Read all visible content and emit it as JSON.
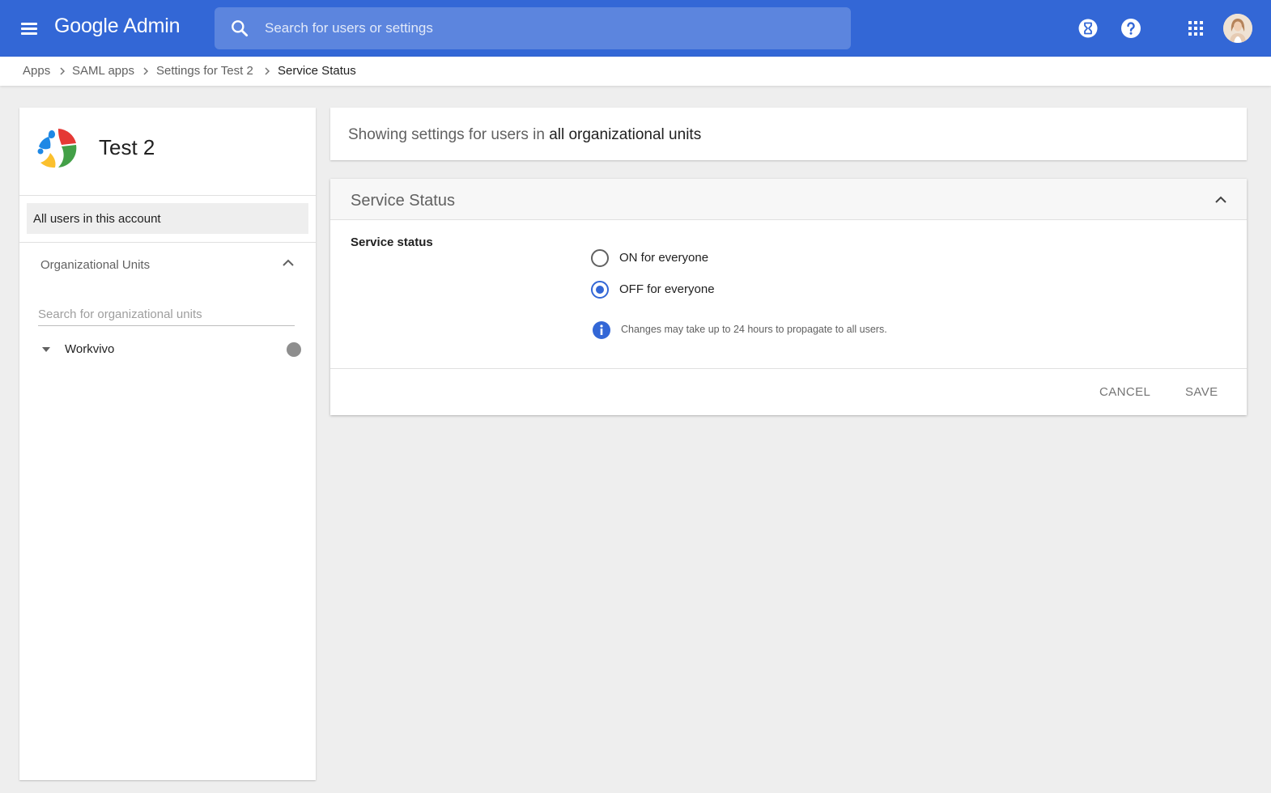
{
  "topbar": {
    "brand_primary": "Google",
    "brand_secondary": "Admin",
    "search_placeholder": "Search for users or settings",
    "color": "#3367d6"
  },
  "breadcrumb": {
    "items": [
      "Apps",
      "SAML apps",
      "Settings for Test 2"
    ],
    "current": "Service Status"
  },
  "sidebar": {
    "app_name": "Test 2",
    "all_users_label": "All users in this account",
    "ou_header": "Organizational Units",
    "ou_search_placeholder": "Search for organizational units",
    "tree": [
      {
        "label": "Workvivo"
      }
    ]
  },
  "scope": {
    "prefix": "Showing settings for users in",
    "target": "all organizational units"
  },
  "settings_card": {
    "title": "Service Status",
    "field_label": "Service status",
    "options": [
      {
        "label": "ON for everyone",
        "selected": false
      },
      {
        "label": "OFF for everyone",
        "selected": true
      }
    ],
    "info_text": "Changes may take up to 24 hours to propagate to all users.",
    "cancel_label": "CANCEL",
    "save_label": "SAVE"
  },
  "icons": {
    "menu": "menu-icon",
    "search": "search-icon",
    "hourglass": "hourglass-icon",
    "help": "help-icon",
    "apps": "apps-grid-icon",
    "avatar": "avatar",
    "info": "info-icon"
  }
}
